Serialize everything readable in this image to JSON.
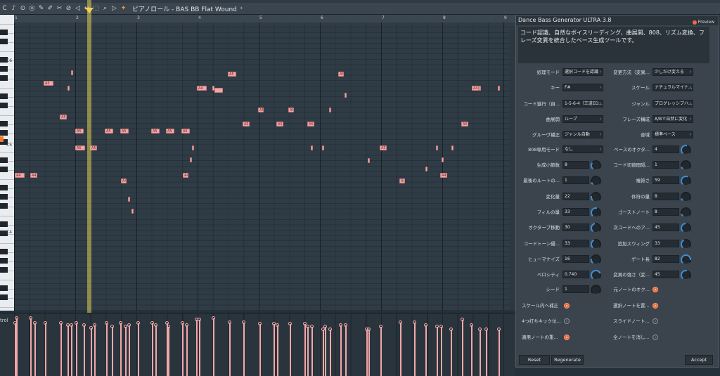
{
  "window": {
    "title": "ピアノロール - BAS BB Flat Wound"
  },
  "piano_roll": {
    "ruler": [
      "1",
      "2",
      "3",
      "4",
      "5",
      "6",
      "7",
      "8",
      "9"
    ],
    "key_labels": [
      "C6",
      "C5",
      "C4"
    ],
    "control_label": "trol"
  },
  "plugin": {
    "title": "Dance Bass Generator ULTRA 3.8",
    "preview_label": "Preview",
    "description": "コード認識、自然なボイスリーディング、曲展開、808、リズム変換、フレーズ変異を統合したベース生成ツールです。",
    "rows": [
      {
        "left_label": "処理モード",
        "left_value": "選択コードを認識",
        "right_label": "変更方法（変異...",
        "right_value": "少しだけ変える"
      },
      {
        "left_label": "キー",
        "left_value": "F#",
        "right_label": "スケール",
        "right_value": "ナチュラルマイナ..."
      },
      {
        "left_label": "コード進行（自...",
        "left_value": "1-5-6-4（王道ED...",
        "right_label": "ジャンル",
        "right_value": "プログレッシブハ..."
      },
      {
        "left_label": "曲展開",
        "left_value": "ループ",
        "right_label": "フレーズ構成",
        "right_value": "A/Bで自然に変化"
      },
      {
        "left_label": "グルーヴ補正",
        "left_value": "ジャンル自動",
        "right_label": "音域",
        "right_value": "標準ベース"
      }
    ],
    "mode_808": {
      "label": "808専用モード",
      "value": "なし",
      "right_label": "ベースのオクタ...",
      "right_value": "4"
    },
    "knob_rows": [
      {
        "left_label": "生成小節数",
        "left_value": "8",
        "right_label": "コード切替間隔...",
        "right_value": "1"
      },
      {
        "left_label": "最後のルートの...",
        "left_value": "1",
        "right_label": "複雑さ",
        "right_value": "59"
      },
      {
        "left_label": "変化量",
        "left_value": "22",
        "right_label": "休符の量",
        "right_value": "8"
      },
      {
        "left_label": "フィルの量",
        "left_value": "33",
        "right_label": "ゴーストノート",
        "right_value": "8"
      },
      {
        "left_label": "オクターブ移動",
        "left_value": "30",
        "right_label": "次コードへのア...",
        "right_value": "45"
      },
      {
        "left_label": "コードトーン優...",
        "left_value": "33",
        "right_label": "追加スウィング",
        "right_value": "33"
      },
      {
        "left_label": "ヒューマナイズ",
        "left_value": "16",
        "right_label": "ゲート長",
        "right_value": "82"
      },
      {
        "left_label": "ベロシティ",
        "left_value": "0.740",
        "right_label": "変異の強さ（変...",
        "right_value": "45"
      }
    ],
    "seed": {
      "label": "シード",
      "value": "1",
      "right_label": "元ノートのオク..."
    },
    "toggles": [
      {
        "left_label": "スケール内へ補正",
        "left_on": true,
        "right_label": "選択ノートを置...",
        "right_on": true
      },
      {
        "left_label": "4つ打ちキック位...",
        "left_on": false,
        "right_label": "スライドノート...",
        "right_on": false
      },
      {
        "left_label": "適用ノートの重...",
        "left_on": true,
        "right_label": "全ノートを消し...",
        "right_on": false
      }
    ],
    "buttons": {
      "reset": "Reset",
      "regenerate": "Regenerate",
      "accept": "Accept"
    },
    "colors": {
      "accent": "#f06a3a",
      "knob_arc": "#3b8fd8",
      "note": "#f4a5a5",
      "playhead": "#e2cf56"
    }
  },
  "notes": [
    {
      "bar": 2.93,
      "row": 10,
      "len": 0.18,
      "label": "A4"
    },
    {
      "bar": 3.2,
      "row": 10,
      "len": 0.1,
      "label": "A4"
    },
    {
      "bar": 3.5,
      "row": 3,
      "len": 0.05,
      "label": ""
    },
    {
      "bar": 3.58,
      "row": 6,
      "len": 0.05,
      "label": ""
    },
    {
      "bar": 3.65,
      "row": 1,
      "len": 0.05,
      "label": ""
    },
    {
      "bar": 2.47,
      "row": 6,
      "len": 0.15,
      "label": "A5"
    }
  ]
}
